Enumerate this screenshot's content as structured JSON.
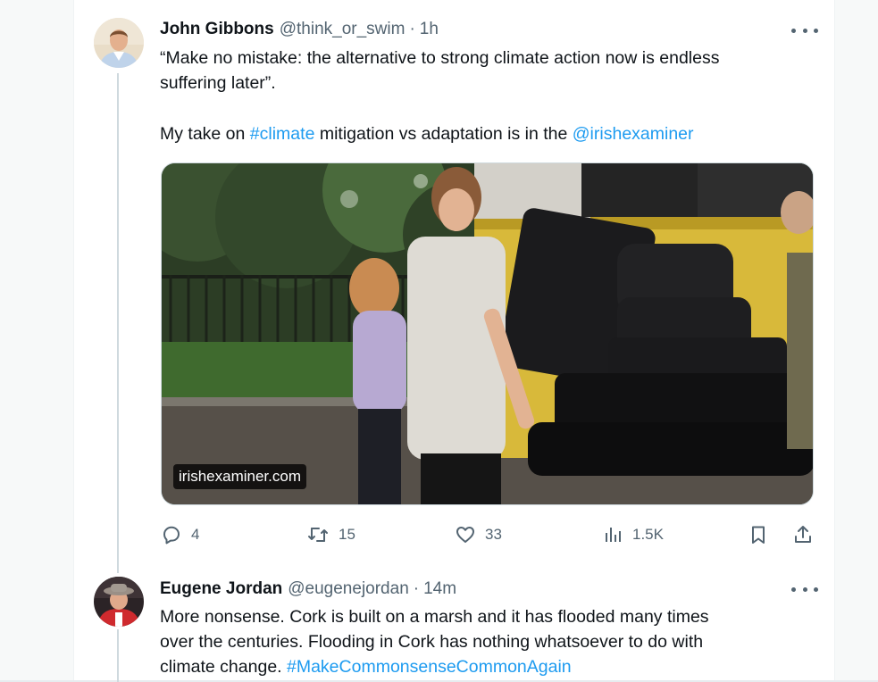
{
  "tweets": [
    {
      "name": "John Gibbons",
      "handle": "@think_or_swim",
      "dot": "·",
      "time": "1h",
      "text_line1": "“Make no mistake: the alternative to strong climate action now is endless",
      "text_line2": "suffering later”.",
      "text_line3_pre": "My take on ",
      "text_line3_hashtag": "#climate",
      "text_line3_mid": " mitigation vs adaptation is in the ",
      "text_line3_mention": "@irishexaminer",
      "media_domain": "irishexaminer.com",
      "actions": {
        "replies": "4",
        "reposts": "15",
        "likes": "33",
        "views": "1.5K"
      }
    },
    {
      "name": "Eugene Jordan",
      "handle": "@eugenejordan",
      "dot": "·",
      "time": "14m",
      "text_line1": "More nonsense. Cork is built on a marsh and it has flooded many times",
      "text_line2": "over the centuries. Flooding in Cork has nothing whatsoever to do with",
      "text_line3_pre": "climate change. ",
      "text_line3_hashtag": "#MakeCommonsenseCommonAgain"
    }
  ],
  "icons": {
    "reply": "reply-icon",
    "repost": "repost-icon",
    "like": "heart-icon",
    "views": "views-icon",
    "bookmark": "bookmark-icon",
    "share": "share-icon",
    "more": "more-icon"
  },
  "colors": {
    "link": "#1d9bf0",
    "secondary_text": "#536471",
    "primary_text": "#0f1419",
    "thread_line": "#cfd9de"
  }
}
